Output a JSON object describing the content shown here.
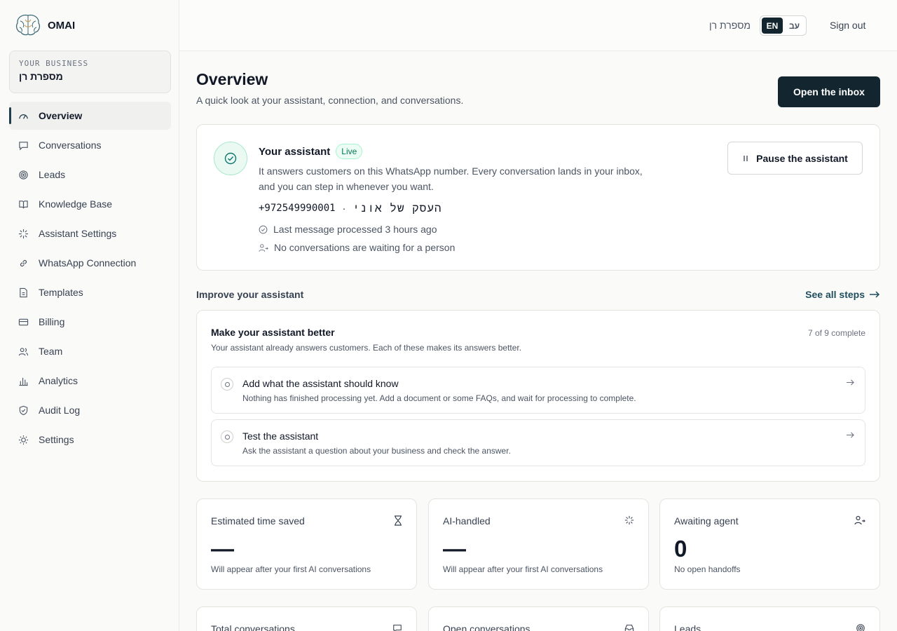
{
  "brand": {
    "name": "OMAI"
  },
  "business": {
    "label": "YOUR BUSINESS",
    "name": "מספרת רן"
  },
  "sidebar": {
    "items": [
      {
        "label": "Overview",
        "icon": "gauge-icon"
      },
      {
        "label": "Conversations",
        "icon": "chat-bubble-icon"
      },
      {
        "label": "Leads",
        "icon": "target-icon"
      },
      {
        "label": "Knowledge Base",
        "icon": "book-icon"
      },
      {
        "label": "Assistant Settings",
        "icon": "sparkle-icon"
      },
      {
        "label": "WhatsApp Connection",
        "icon": "link-icon"
      },
      {
        "label": "Templates",
        "icon": "document-icon"
      },
      {
        "label": "Billing",
        "icon": "credit-card-icon"
      },
      {
        "label": "Team",
        "icon": "users-icon"
      },
      {
        "label": "Analytics",
        "icon": "bar-chart-icon"
      },
      {
        "label": "Audit Log",
        "icon": "shield-icon"
      },
      {
        "label": "Settings",
        "icon": "sun-gear-icon"
      }
    ]
  },
  "topbar": {
    "business": "מספרת רן",
    "lang_en": "EN",
    "lang_he": "עב",
    "signout": "Sign out"
  },
  "page": {
    "title": "Overview",
    "subtitle": "A quick look at your assistant, connection, and conversations.",
    "inbox_button": "Open the inbox"
  },
  "assistant": {
    "title": "Your assistant",
    "badge": "Live",
    "description": "It answers customers on this WhatsApp number. Every conversation lands in your inbox, and you can step in whenever you want.",
    "phone": "+972549990001",
    "separator": "·",
    "business_name": "העסק של אוני",
    "last_message": "Last message processed 3 hours ago",
    "waiting": "No conversations are waiting for a person",
    "pause_button": "Pause the assistant"
  },
  "improve": {
    "section_title": "Improve your assistant",
    "see_all": "See all steps",
    "card_title": "Make your assistant better",
    "progress": "7 of 9 complete",
    "description": "Your assistant already answers customers. Each of these makes its answers better.",
    "steps": [
      {
        "title": "Add what the assistant should know",
        "desc": "Nothing has finished processing yet. Add a document or some FAQs, and wait for processing to complete."
      },
      {
        "title": "Test the assistant",
        "desc": "Ask the assistant a question about your business and check the answer."
      }
    ]
  },
  "stats": [
    {
      "label": "Estimated time saved",
      "value": "—",
      "note": "Will appear after your first AI conversations",
      "icon": "hourglass-icon"
    },
    {
      "label": "AI-handled",
      "value": "—",
      "note": "Will appear after your first AI conversations",
      "icon": "sparkle-icon"
    },
    {
      "label": "Awaiting agent",
      "value": "0",
      "note": "No open handoffs",
      "icon": "user-arrow-icon"
    },
    {
      "label": "Total conversations",
      "icon": "chat-bubble-icon"
    },
    {
      "label": "Open conversations",
      "icon": "inbox-icon"
    },
    {
      "label": "Leads",
      "icon": "target-icon"
    }
  ],
  "colors": {
    "accent": "#13252e",
    "live": "#047857",
    "link": "#1f4e5f"
  }
}
